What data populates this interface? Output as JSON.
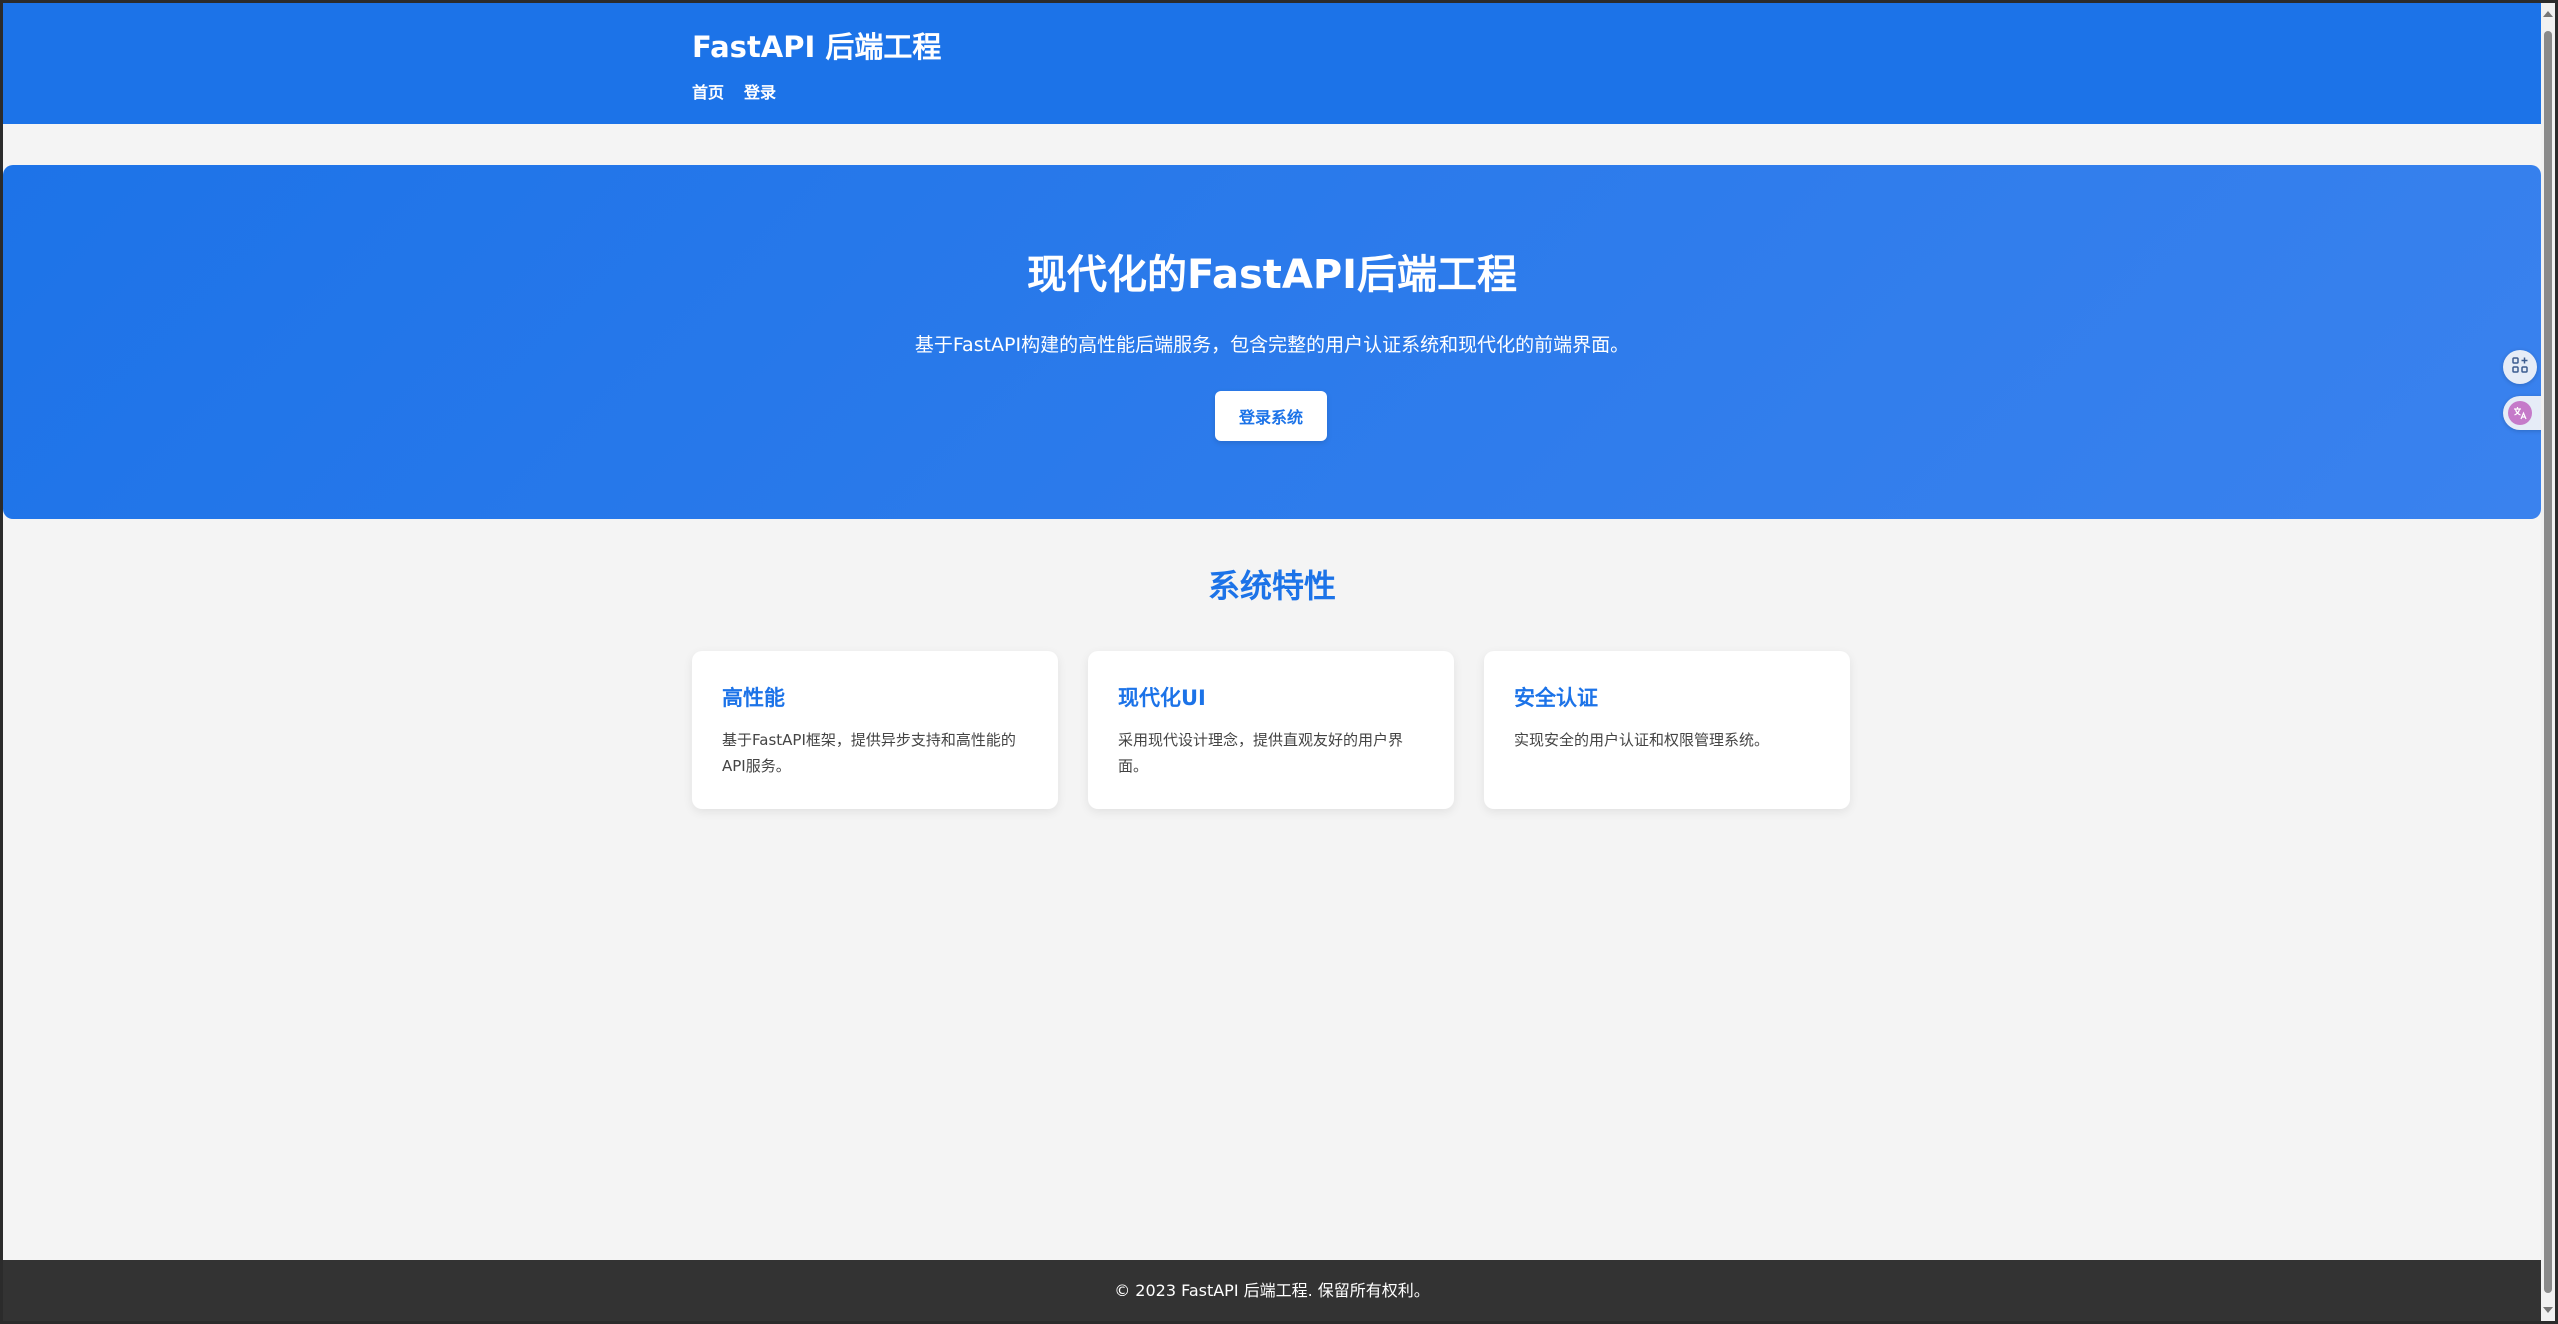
{
  "header": {
    "title": "FastAPI 后端工程",
    "nav": [
      {
        "label": "首页"
      },
      {
        "label": "登录"
      }
    ]
  },
  "hero": {
    "title": "现代化的FastAPI后端工程",
    "description": "基于FastAPI构建的高性能后端服务，包含完整的用户认证系统和现代化的前端界面。",
    "button_label": "登录系统"
  },
  "features": {
    "title": "系统特性",
    "cards": [
      {
        "title": "高性能",
        "text": "基于FastAPI框架，提供异步支持和高性能的API服务。"
      },
      {
        "title": "现代化UI",
        "text": "采用现代设计理念，提供直观友好的用户界面。"
      },
      {
        "title": "安全认证",
        "text": "实现安全的用户认证和权限管理系统。"
      }
    ]
  },
  "footer": {
    "text": "© 2023 FastAPI 后端工程. 保留所有权利。"
  },
  "side_widgets": [
    {
      "icon": "apps-add-icon"
    },
    {
      "icon": "translate-icon"
    }
  ],
  "colors": {
    "primary": "#1c73e8",
    "footer_bg": "#333333",
    "page_bg": "#f4f4f4"
  }
}
